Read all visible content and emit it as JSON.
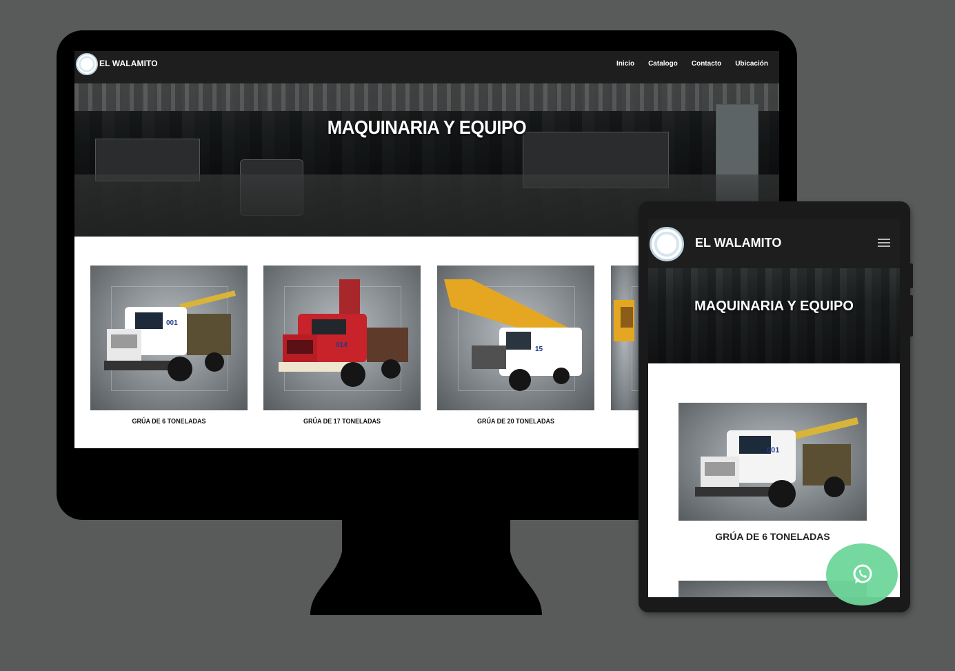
{
  "site": {
    "brand": "EL WALAMITO",
    "nav": [
      "Inicio",
      "Catalogo",
      "Contacto",
      "Ubicación"
    ],
    "hero_title": "MAQUINARIA Y EQUIPO"
  },
  "desktop": {
    "cards": [
      {
        "label": "GRÚA DE 6 TONELADAS",
        "cab_color": "#ffffff",
        "number": "001"
      },
      {
        "label": "GRÚA DE 17 TONELADAS",
        "cab_color": "#c8222a",
        "number": "014"
      },
      {
        "label": "GRÚA DE 20 TONELADAS",
        "cab_color": "#ffffff",
        "number": "15"
      }
    ]
  },
  "tablet": {
    "brand": "EL WALAMITO",
    "hero_title": "MAQUINARIA Y EQUIPO",
    "card_label": "GRÚA DE 6 TONELADAS"
  },
  "colors": {
    "background": "#595b5a",
    "navbar": "#1e1e1e",
    "whatsapp": "#6dd69a"
  },
  "icons": [
    "logo-badge-icon",
    "hamburger-menu-icon",
    "whatsapp-icon"
  ]
}
